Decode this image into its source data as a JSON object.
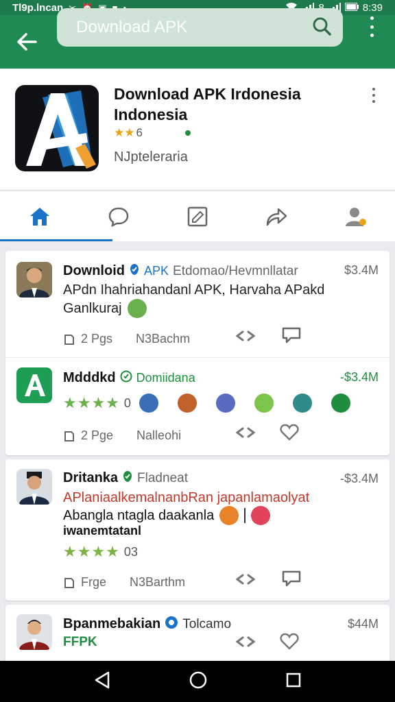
{
  "status_bar": {
    "carrier": "Tl9p.lncan",
    "time": "8:39",
    "signal_text": "8"
  },
  "app_bar": {
    "search_text": "Download APK"
  },
  "app": {
    "title": "Download APK Irdonesia Indonesia",
    "rating_text": "6",
    "developer": "NJpteleraria"
  },
  "tabs": [
    {
      "name": "home-icon"
    },
    {
      "name": "chat-icon"
    },
    {
      "name": "edit-icon"
    },
    {
      "name": "share-icon"
    },
    {
      "name": "profile-icon"
    }
  ],
  "posts": [
    {
      "name": "Downloid",
      "badge": "APK",
      "sub": "Etdomao/Hevmnllatar",
      "price": "$3.4M",
      "line1": "APdn Ihahriahandanl APK, Harvaha APakd",
      "line2": "Ganlkuraj",
      "meta1": "2 Pgs",
      "meta2": "N3Bachm"
    },
    {
      "name": "Mdddkd",
      "badge": "Domiidana",
      "price": "-$3.4M",
      "rating_count": "0",
      "meta1": "2 Pge",
      "meta2": "Nalleohi"
    },
    {
      "name": "Dritanka",
      "badge": "Fladneat",
      "price": "-$3.4M",
      "line1": "APlaniaalkemalnanbRan japanlamaolyat",
      "line2": "Abangla ntagla daakanla",
      "line3": "iwanemtatanl",
      "rating_count": "03",
      "meta1": "Frge",
      "meta2": "N3Barthm"
    },
    {
      "name": "Bpanmebakian",
      "badge": "Tolcamo",
      "price": "$44M",
      "line1": "FFPK"
    }
  ],
  "colors": {
    "status_bar": "#1d7a4a",
    "app_bar": "#1f8a52",
    "tab_accent": "#1a73c8",
    "star_green": "#6ab04c",
    "star_yellow": "#e8a317"
  }
}
